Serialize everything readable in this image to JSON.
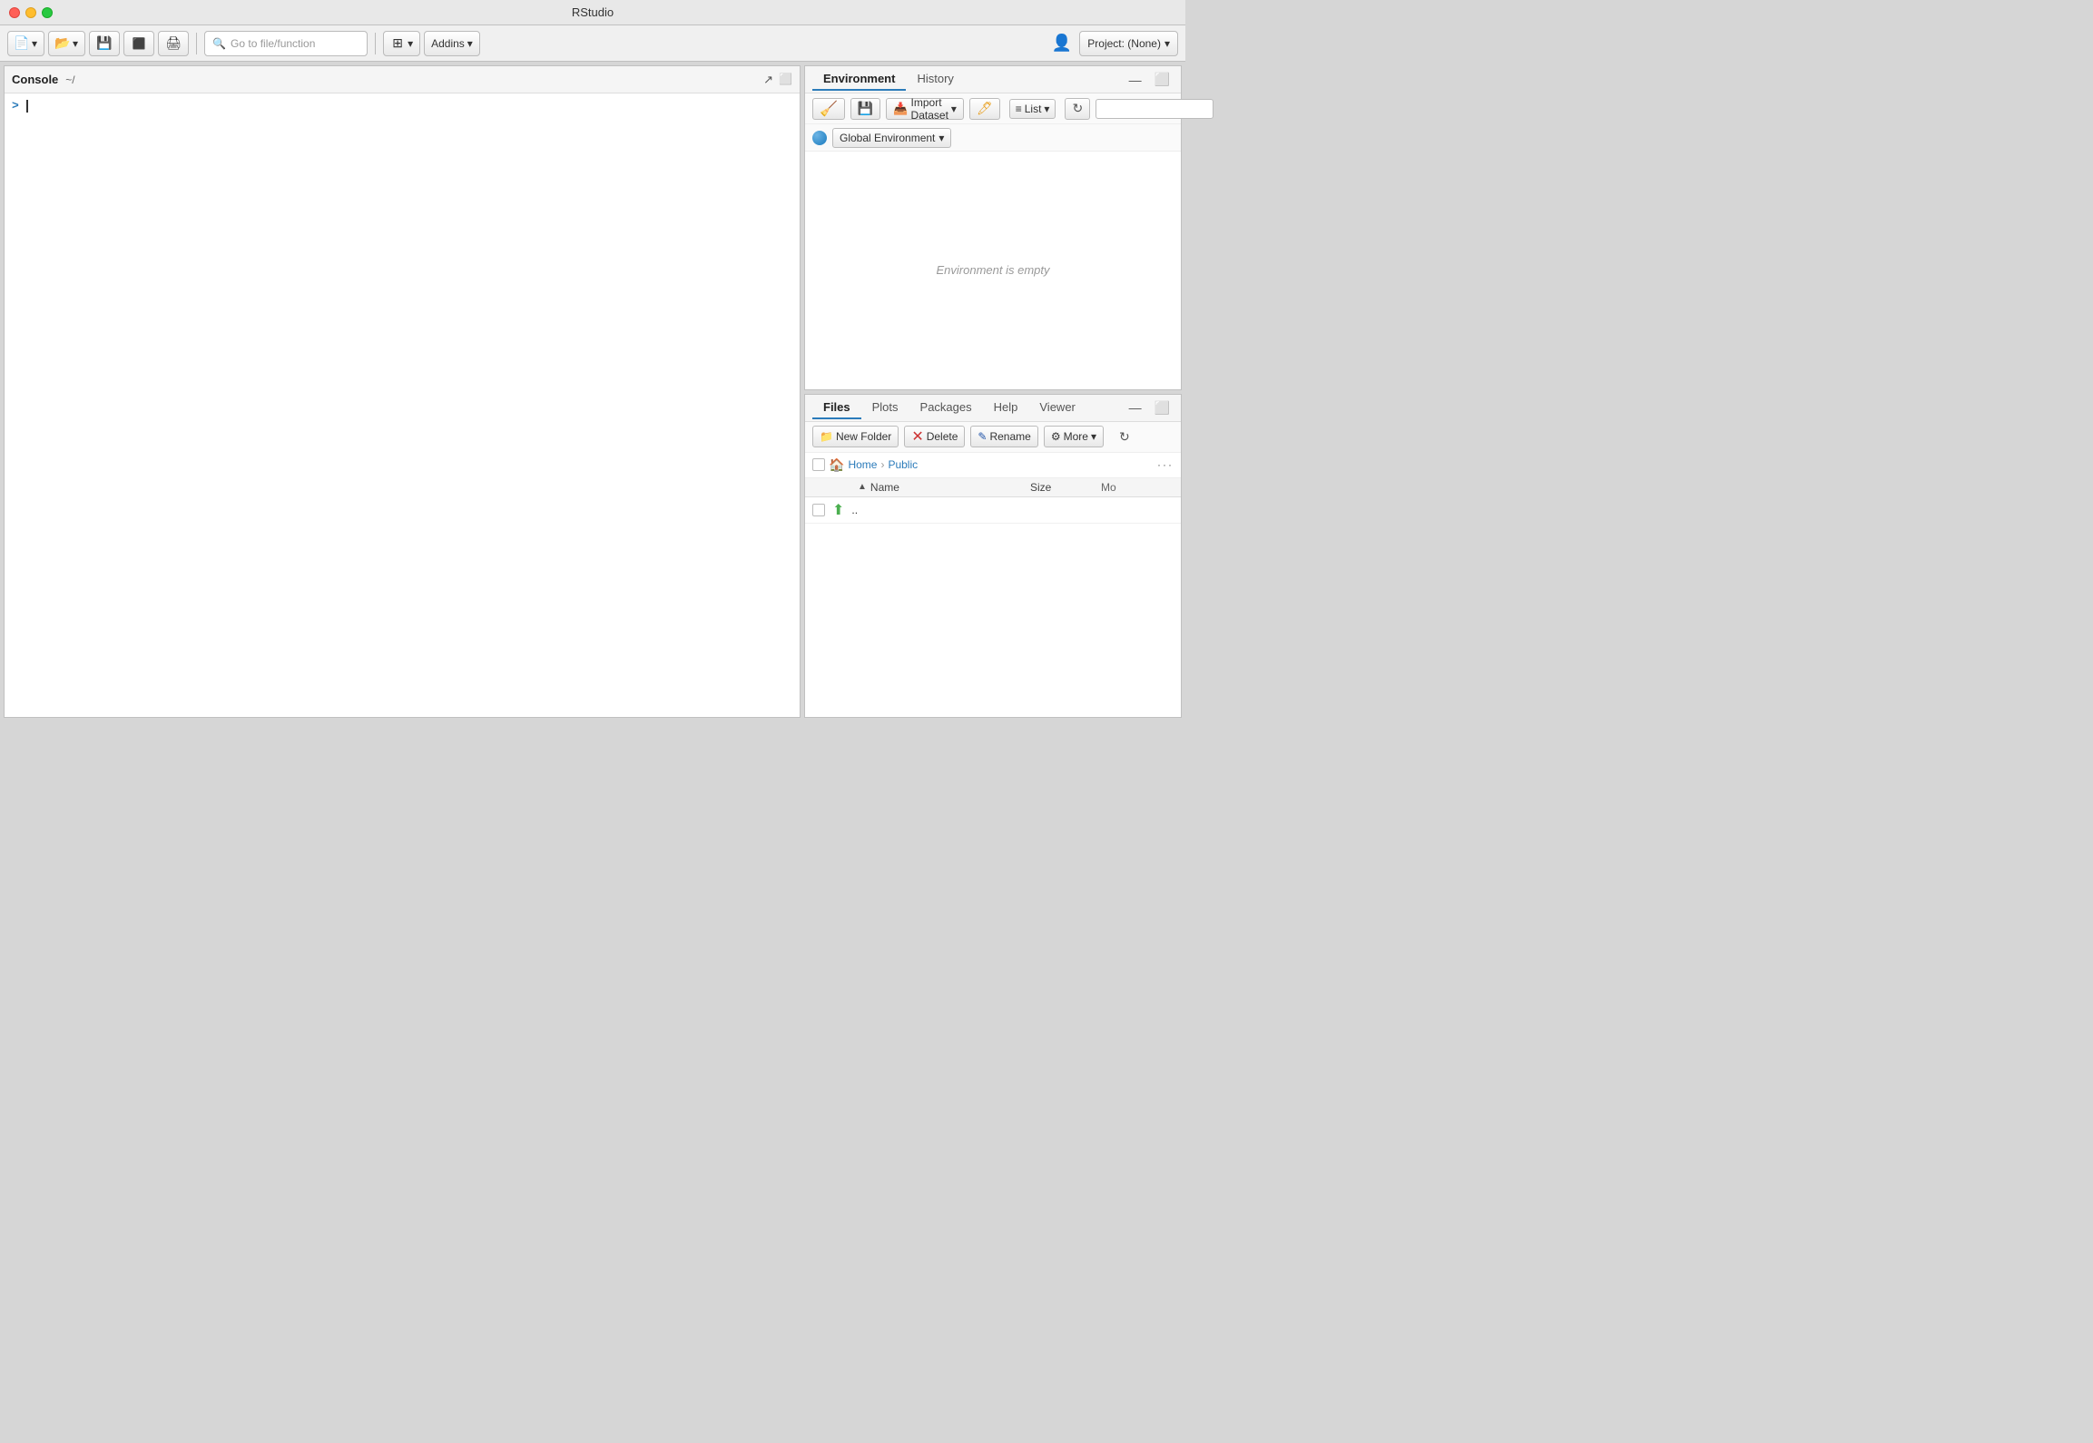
{
  "window": {
    "title": "RStudio"
  },
  "titlebar": {
    "title": "RStudio"
  },
  "toolbar": {
    "new_btn": "New",
    "open_btn": "Open",
    "save_btn": "",
    "save_all_btn": "",
    "print_btn": "",
    "goto_placeholder": "Go to file/function",
    "workspace_btn": "",
    "addins_label": "Addins",
    "project_label": "Project: (None)"
  },
  "console": {
    "title": "Console",
    "path": "~/",
    "prompt": ">",
    "empty_state": ""
  },
  "environment": {
    "tab_environment": "Environment",
    "tab_history": "History",
    "broom_tooltip": "Clear console",
    "save_tooltip": "Save",
    "import_btn": "Import Dataset",
    "broom_btn": "",
    "list_btn": "List",
    "global_env": "Global Environment",
    "empty_message": "Environment is empty",
    "search_placeholder": ""
  },
  "files": {
    "tab_files": "Files",
    "tab_plots": "Plots",
    "tab_packages": "Packages",
    "tab_help": "Help",
    "tab_viewer": "Viewer",
    "new_folder_btn": "New Folder",
    "delete_btn": "Delete",
    "rename_btn": "Rename",
    "more_btn": "More",
    "breadcrumb_home": "Home",
    "breadcrumb_public": "Public",
    "col_name": "Name",
    "col_size": "Size",
    "col_modified": "Mo",
    "sort_indicator": "▲",
    "parent_dir": "..",
    "more_dots": "···"
  }
}
